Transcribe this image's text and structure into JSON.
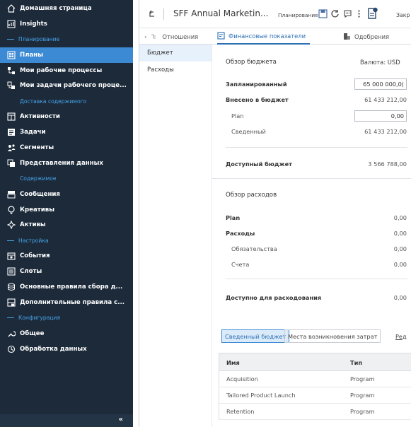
{
  "sidebar": {
    "items": [
      {
        "kind": "item",
        "label": "Домашняя страница",
        "icon": "home-icon"
      },
      {
        "kind": "item",
        "label": "Insights",
        "icon": "insights-icon"
      },
      {
        "kind": "section",
        "label": "Планирование",
        "style": "dash"
      },
      {
        "kind": "item",
        "label": "Планы",
        "icon": "plans-icon",
        "active": true
      },
      {
        "kind": "item",
        "label": "Мои рабочие процессы",
        "icon": "workflows-icon"
      },
      {
        "kind": "item",
        "label": "Мои задачи рабочего проце...",
        "icon": "workflow-tasks-icon"
      },
      {
        "kind": "section",
        "label": "Доставка содержимого",
        "style": "indent"
      },
      {
        "kind": "item",
        "label": "Активности",
        "icon": "activities-icon"
      },
      {
        "kind": "item",
        "label": "Задачи",
        "icon": "tasks-icon"
      },
      {
        "kind": "item",
        "label": "Сегменты",
        "icon": "segments-icon"
      },
      {
        "kind": "item",
        "label": "Представления данных",
        "icon": "data-views-icon"
      },
      {
        "kind": "section",
        "label": "Содержимое",
        "style": "indent"
      },
      {
        "kind": "item",
        "label": "Сообщения",
        "icon": "messages-icon"
      },
      {
        "kind": "item",
        "label": "Креативы",
        "icon": "creatives-icon"
      },
      {
        "kind": "item",
        "label": "Активы",
        "icon": "assets-icon"
      },
      {
        "kind": "section",
        "label": "Настройка",
        "style": "dash"
      },
      {
        "kind": "item",
        "label": "События",
        "icon": "events-icon"
      },
      {
        "kind": "item",
        "label": "Слоты",
        "icon": "slots-icon"
      },
      {
        "kind": "item",
        "label": "Основные правила сбора д...",
        "icon": "basic-rules-icon"
      },
      {
        "kind": "item",
        "label": "Дополнительные правила с...",
        "icon": "additional-rules-icon"
      },
      {
        "kind": "section",
        "label": "Конфигурация",
        "style": "dash"
      },
      {
        "kind": "item",
        "label": "Общее",
        "icon": "general-icon"
      },
      {
        "kind": "item",
        "label": "Обработка данных",
        "icon": "data-processing-icon"
      }
    ],
    "collapse_label": "«"
  },
  "header": {
    "title": "SFF Annual Marketin...",
    "tag": "Планирование",
    "close_label": "Закр"
  },
  "tabs": [
    {
      "label": "Отношения",
      "icon": "relations-icon"
    },
    {
      "label": "Финансовые показатели",
      "icon": "finance-icon",
      "active": true
    },
    {
      "label": "Одобрения",
      "icon": "approvals-icon"
    }
  ],
  "subnav": [
    "Бюджет",
    "Расходы"
  ],
  "budget": {
    "title": "Обзор бюджета",
    "currency": "Валюта: USD",
    "planned_label": "Запланированный",
    "planned_value": "65 000 000,0(",
    "budgeted_label": "Внесено в бюджет",
    "budgeted_value": "61 433 212,00",
    "plan_label": "Plan",
    "plan_value": "0,00",
    "consolidated_label": "Сведенный",
    "consolidated_value": "61 433 212,00",
    "available_label": "Доступный бюджет",
    "available_value": "3 566 788,00"
  },
  "expenses": {
    "title": "Обзор расходов",
    "plan_label": "Plan",
    "plan_value": "0,00",
    "expenses_label": "Расходы",
    "expenses_value": "0,00",
    "obligations_label": "Обязательства",
    "obligations_value": "0,00",
    "invoices_label": "Счета",
    "invoices_value": "0,00",
    "available_label": "Доступно для расходования",
    "available_value": "0,00"
  },
  "segments": {
    "consolidated": "Сведенный бюджет",
    "cost_centers": "Места возникновения затрат",
    "edit": "Ред"
  },
  "table": {
    "headers": [
      "Имя",
      "Тип"
    ],
    "rows": [
      [
        "Acquisition",
        "Program"
      ],
      [
        "Tailored Product Launch",
        "Program"
      ],
      [
        "Retention",
        "Program"
      ]
    ]
  }
}
